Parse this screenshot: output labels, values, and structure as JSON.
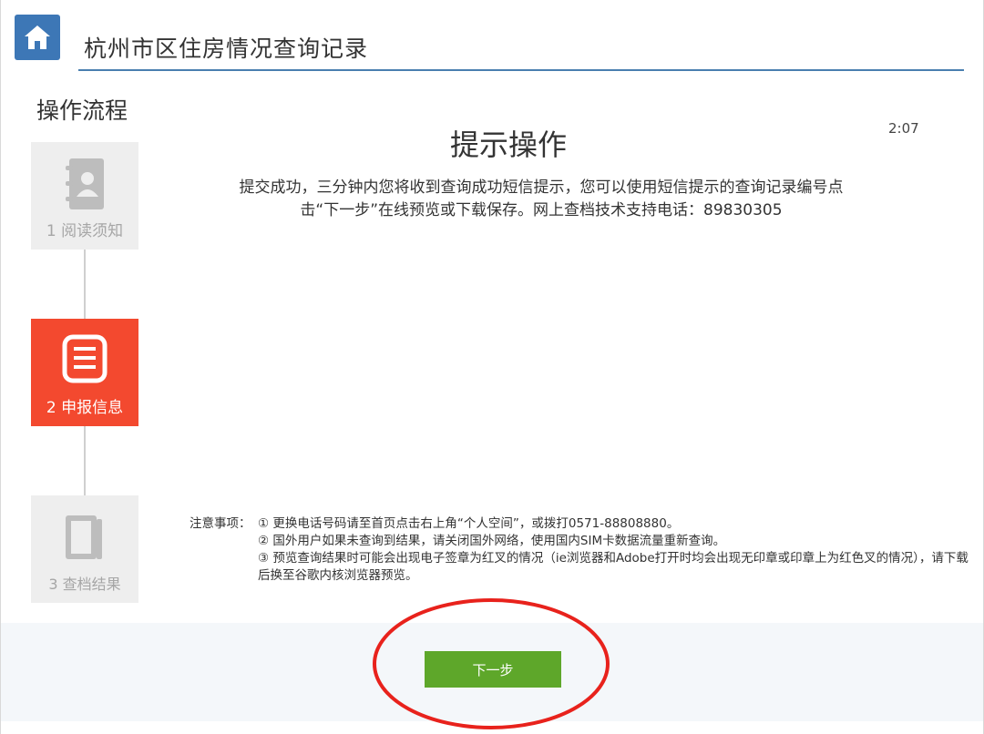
{
  "header": {
    "home_icon": "home-icon",
    "title": "杭州市区住房情况查询记录",
    "accent_color": "#3d77b6"
  },
  "sidebar": {
    "title": "操作流程",
    "steps": [
      {
        "number": "1",
        "label": "1 阅读须知",
        "icon": "contact-book-icon",
        "state": "done"
      },
      {
        "number": "2",
        "label": "2 申报信息",
        "icon": "form-list-icon",
        "state": "active",
        "color": "#f3492f"
      },
      {
        "number": "3",
        "label": "3 查档结果",
        "icon": "book-icon",
        "state": "pending"
      }
    ]
  },
  "main": {
    "timer": "2:07",
    "heading": "提示操作",
    "message_line1": "提交成功，三分钟内您将收到查询成功短信提示，您可以使用短信提示的查询记录编号点",
    "message_line2": "击“下一步”在线预览或下载保存。网上查档技术支持电话：89830305",
    "notes": {
      "label": "注意事项：",
      "items": [
        "① 更换电话号码请至首页点击右上角“个人空间”，或拨打0571-88808880。",
        "② 国外用户如果未查询到结果，请关闭国外网络，使用国内SIM卡数据流量重新查询。",
        "③ 预览查询结果时可能会出现电子签章为红叉的情况（ie浏览器和Adobe打开时均会出现无印章或印章上为红色叉的情况），请下载后换至谷歌内核浏览器预览。"
      ]
    }
  },
  "footer": {
    "next_label": "下一步",
    "next_color": "#5ea72a",
    "annotation_color": "#e8221c"
  }
}
